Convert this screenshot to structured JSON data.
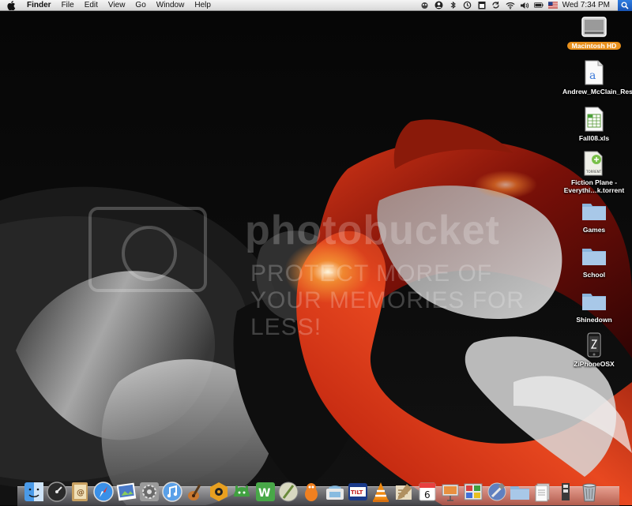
{
  "menubar": {
    "app_name": "Finder",
    "items": [
      "File",
      "Edit",
      "View",
      "Go",
      "Window",
      "Help"
    ],
    "clock": "Wed 7:34 PM"
  },
  "desktop": {
    "icons": [
      {
        "label": "Macintosh HD",
        "kind": "hard-drive",
        "selected": true
      },
      {
        "label": "Andrew_McClain_Resume",
        "kind": "text-document"
      },
      {
        "label": "Fall08.xls",
        "kind": "spreadsheet"
      },
      {
        "label": "Fiction Plane - Everythi…k.torrent",
        "kind": "torrent-file"
      },
      {
        "label": "Games",
        "kind": "folder"
      },
      {
        "label": "School",
        "kind": "folder"
      },
      {
        "label": "Shinedown",
        "kind": "folder"
      },
      {
        "label": "ZiPhoneOSX",
        "kind": "iphone-app"
      }
    ]
  },
  "watermark": {
    "line1": "photobucket",
    "line2": "PROTECT MORE OF YOUR MEMORIES FOR LESS!"
  },
  "dock": {
    "items": [
      {
        "name": "finder",
        "color": "#3d8fe0"
      },
      {
        "name": "dashboard",
        "color": "#2a2a2a"
      },
      {
        "name": "address-book",
        "color": "#c8a060"
      },
      {
        "name": "safari",
        "color": "#3a90e8"
      },
      {
        "name": "iphoto",
        "color": "#4a7ac8"
      },
      {
        "name": "system-preferences",
        "color": "#8a8a8a"
      },
      {
        "name": "itunes",
        "color": "#5aa0e8"
      },
      {
        "name": "garageband",
        "color": "#c87830"
      },
      {
        "name": "reason",
        "color": "#e8a020"
      },
      {
        "name": "adium",
        "color": "#40a040"
      },
      {
        "name": "dreamweaver",
        "color": "#48a848"
      },
      {
        "name": "textwrangler",
        "color": "#d8d8c0"
      },
      {
        "name": "vlc-mascot",
        "color": "#f08020"
      },
      {
        "name": "preview",
        "color": "#88bbe0"
      },
      {
        "name": "full-tilt-poker",
        "color": "#1a3a8a"
      },
      {
        "name": "vlc",
        "color": "#f08a10"
      },
      {
        "name": "script-editor",
        "color": "#b09060"
      },
      {
        "name": "ical",
        "color": "#e84040"
      },
      {
        "name": "keynote",
        "color": "#e8e8e8"
      },
      {
        "name": "photo-booth",
        "color": "#d84040"
      },
      {
        "name": "xcode",
        "color": "#6080c0"
      },
      {
        "name": "applications-folder",
        "color": "#9ab8d8"
      },
      {
        "name": "documents-folder",
        "color": "#e8e8e8"
      },
      {
        "name": "stack",
        "color": "#e0e0e0"
      },
      {
        "name": "trash",
        "color": "#b0b8c0"
      }
    ],
    "ical_day": "6"
  }
}
